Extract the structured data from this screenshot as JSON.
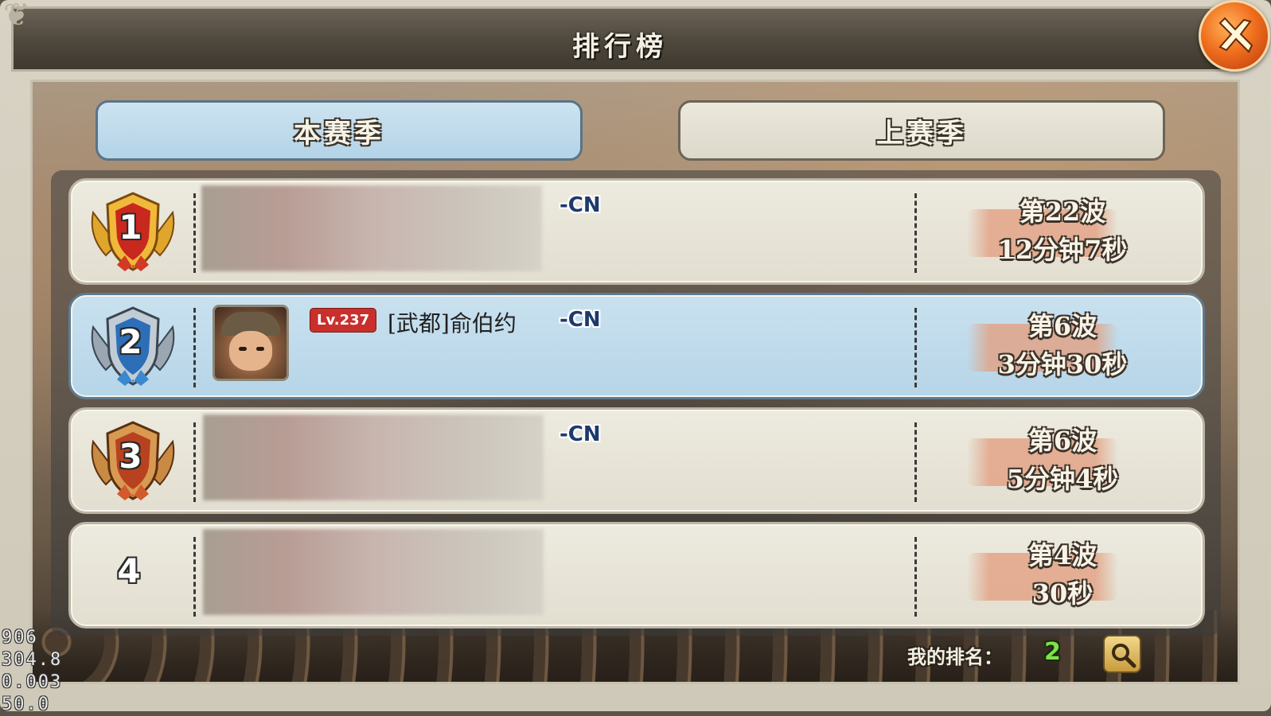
{
  "window": {
    "title": "排行榜"
  },
  "tabs": [
    {
      "label": "本赛季",
      "active": true
    },
    {
      "label": "上赛季",
      "active": false
    }
  ],
  "rows": [
    {
      "rank": "1",
      "medal": "gold-medal-icon",
      "server": "-CN",
      "wave": "第22波",
      "time": "12分钟7秒",
      "player_visible": false
    },
    {
      "rank": "2",
      "medal": "silver-medal-icon",
      "level": "Lv.237",
      "name": "[武都]俞伯约",
      "server": "-CN",
      "wave": "第6波",
      "time": "3分钟30秒",
      "player_visible": true,
      "highlight": true
    },
    {
      "rank": "3",
      "medal": "bronze-medal-icon",
      "server": "-CN",
      "wave": "第6波",
      "time": "5分钟4秒",
      "player_visible": false
    },
    {
      "rank": "4",
      "wave": "第4波",
      "time": "30秒",
      "player_visible": false
    }
  ],
  "footer": {
    "my_rank_label": "我的排名：",
    "my_rank_value": "2"
  },
  "debug": [
    "906",
    "304.8",
    "0.003",
    "50.0"
  ],
  "colors": {
    "gold": "#f0b93a",
    "silver": "#9fb3c6",
    "bronze": "#c9743a",
    "highlight_row": "#b6d5e8",
    "my_rank": "#7fe04a",
    "close_btn": "#f0701e"
  }
}
